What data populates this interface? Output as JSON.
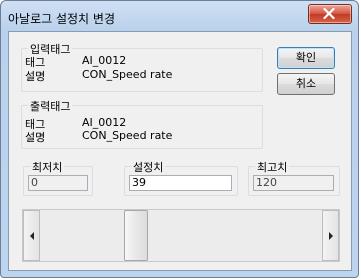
{
  "window": {
    "title": "아날로그 설정치 변경"
  },
  "input_tag": {
    "group_label": "입력태그",
    "tag_label": "태그",
    "tag_value": "AI_0012",
    "desc_label": "설명",
    "desc_value": "CON_Speed rate"
  },
  "output_tag": {
    "group_label": "출력태그",
    "tag_label": "태그",
    "tag_value": "AI_0012",
    "desc_label": "설명",
    "desc_value": "CON_Speed rate"
  },
  "buttons": {
    "ok_label": "확인",
    "cancel_label": "취소"
  },
  "min": {
    "label": "최저치",
    "value": "0"
  },
  "setpoint": {
    "label": "설정치",
    "value": "39"
  },
  "max": {
    "label": "최고치",
    "value": "120"
  },
  "slider": {
    "min": 0,
    "max": 120,
    "value": 39
  },
  "icons": {
    "close": "close-icon",
    "left": "arrow-left-icon",
    "right": "arrow-right-icon"
  }
}
